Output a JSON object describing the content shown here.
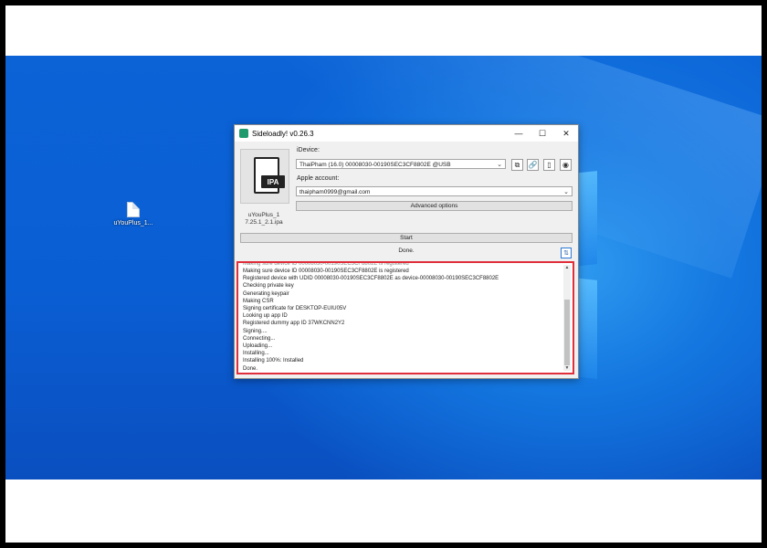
{
  "desktop": {
    "file_icon_label": "uYouPlus_1..."
  },
  "window": {
    "title": "Sideloadly! v0.26.3",
    "controls": [
      "—",
      "☐",
      "✕"
    ],
    "ipa_badge": "IPA",
    "ipa_filename_line1": "uYouPlus_1",
    "ipa_filename_line2": "7.25.1_2.1.ipa",
    "idevice_label": "iDevice:",
    "idevice_value": "ThaiPham (16.0) 00008030-00190SEC3CF8802E @USB",
    "apple_account_label": "Apple account:",
    "apple_account_value": "thaipham0999@gmail.com",
    "advanced_options_label": "Advanced options",
    "start_label": "Start",
    "status_text": "Done.",
    "sort_glyph": "⇅"
  },
  "log": {
    "lines": [
      "Making sure device ID 00008030-00190SEC3CF8802E is registered",
      "Registered device with UDID 00008030-00190SEC3CF8802E as device-00008030-00190SEC3CF8802E",
      "Checking private key",
      "Generating keypair",
      "Making CSR",
      "Signing certificate for DESKTOP-EUIU05V",
      "Looking up app ID",
      "Registered dummy app ID 37WKCNN2Y2",
      "Signing....",
      "Connecting...",
      "Uploading...",
      "Installing...",
      "Installing 100%: Installed",
      "Done."
    ]
  }
}
